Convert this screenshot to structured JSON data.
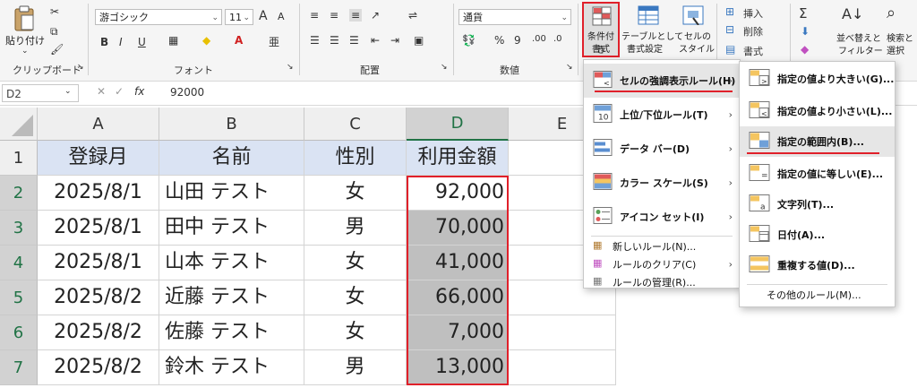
{
  "ribbon": {
    "clipboard": {
      "paste_label": "貼り付け",
      "group_label": "クリップボード"
    },
    "font": {
      "font_name": "游ゴシック",
      "font_size": "11",
      "grow": "A",
      "shrink": "A",
      "bold": "B",
      "italic": "I",
      "underline": "U",
      "group_label": "フォント"
    },
    "alignment": {
      "group_label": "配置"
    },
    "number": {
      "format": "通貨",
      "percent": "%",
      "comma": "9",
      "group_label": "数値"
    },
    "styles": {
      "cond_format_line1": "条件付き",
      "cond_format_line2": "書式",
      "table_line1": "テーブルとして",
      "table_line2": "書式設定",
      "cell_line1": "セルの",
      "cell_line2": "スタイル"
    },
    "cells": {
      "insert": "挿入",
      "delete": "削除",
      "format": "書式"
    },
    "editing": {
      "sum": "Σ",
      "sort_line1": "並べ替えと",
      "sort_line2": "フィルター",
      "find_line1": "検索と",
      "find_line2": "選択"
    }
  },
  "formula_bar": {
    "name_box": "D2",
    "fx": "fx",
    "value": "92000"
  },
  "sheet": {
    "columns": [
      "A",
      "B",
      "C",
      "D",
      "E"
    ],
    "row_numbers": [
      "1",
      "2",
      "3",
      "4",
      "5",
      "6",
      "7"
    ],
    "header": [
      "登録月",
      "名前",
      "性別",
      "利用金額"
    ],
    "rows": [
      [
        "2025/8/1",
        "山田 テスト",
        "女",
        "92,000"
      ],
      [
        "2025/8/1",
        "田中 テスト",
        "男",
        "70,000"
      ],
      [
        "2025/8/1",
        "山本 テスト",
        "女",
        "41,000"
      ],
      [
        "2025/8/2",
        "近藤 テスト",
        "女",
        "66,000"
      ],
      [
        "2025/8/2",
        "佐藤 テスト",
        "女",
        "7,000"
      ],
      [
        "2025/8/2",
        "鈴木 テスト",
        "男",
        "13,000"
      ]
    ]
  },
  "cf_menu": {
    "items": [
      {
        "label": "セルの強調表示ルール(H)",
        "icon": "highlight-rules-icon"
      },
      {
        "label": "上位/下位ルール(T)",
        "icon": "top-bottom-icon"
      },
      {
        "label": "データ バー(D)",
        "icon": "data-bar-icon"
      },
      {
        "label": "カラー スケール(S)",
        "icon": "color-scale-icon"
      },
      {
        "label": "アイコン セット(I)",
        "icon": "icon-set-icon"
      }
    ],
    "actions": [
      {
        "label": "新しいルール(N)..."
      },
      {
        "label": "ルールのクリア(C)"
      },
      {
        "label": "ルールの管理(R)..."
      }
    ]
  },
  "highlight_menu": {
    "items": [
      {
        "label": "指定の値より大きい(G)..."
      },
      {
        "label": "指定の値より小さい(L)..."
      },
      {
        "label": "指定の範囲内(B)..."
      },
      {
        "label": "指定の値に等しい(E)..."
      },
      {
        "label": "文字列(T)..."
      },
      {
        "label": "日付(A)..."
      },
      {
        "label": "重複する値(D)..."
      }
    ],
    "more": "その他のルール(M)..."
  },
  "colors": {
    "accent_green": "#217346",
    "highlight_red": "#e0202a",
    "header_fill": "#dae3f3",
    "selected_fill": "#bfbfbf"
  }
}
